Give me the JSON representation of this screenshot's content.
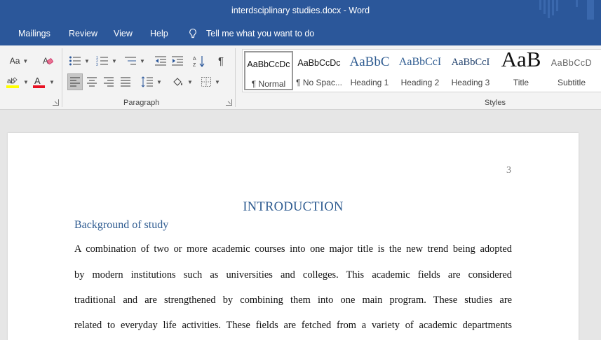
{
  "titlebar": {
    "title": "interdsciplinary studies.docx  -  Word"
  },
  "menu": {
    "items": [
      "Mailings",
      "Review",
      "View",
      "Help"
    ],
    "tell_me": "Tell me what you want to do"
  },
  "ribbon": {
    "font_group": {
      "case_label": "Aa"
    },
    "paragraph_label": "Paragraph",
    "styles_label": "Styles",
    "styles": [
      {
        "preview": "AaBbCcDc",
        "name": "¶ Normal"
      },
      {
        "preview": "AaBbCcDc",
        "name": "¶ No Spac..."
      },
      {
        "preview": "AaBbC",
        "name": "Heading 1"
      },
      {
        "preview": "AaBbCcI",
        "name": "Heading 2"
      },
      {
        "preview": "AaBbCcI",
        "name": "Heading 3"
      },
      {
        "preview": "AaB",
        "name": "Title"
      },
      {
        "preview": "AaBbCcD",
        "name": "Subtitle"
      }
    ],
    "colors": {
      "highlight": "#ffff00",
      "font_color": "#e81123"
    }
  },
  "document": {
    "page_number": "3",
    "heading": "INTRODUCTION",
    "subheading": "Background of study",
    "lines": [
      "A combination of two or more academic courses into one major title is the new trend being adopted",
      "by modern institutions such as universities and colleges. This academic fields are considered",
      "traditional and are strengthened by combining them into one main program. These studies are",
      "related to everyday life activities. These fields are fetched from a variety of academic departments"
    ]
  }
}
